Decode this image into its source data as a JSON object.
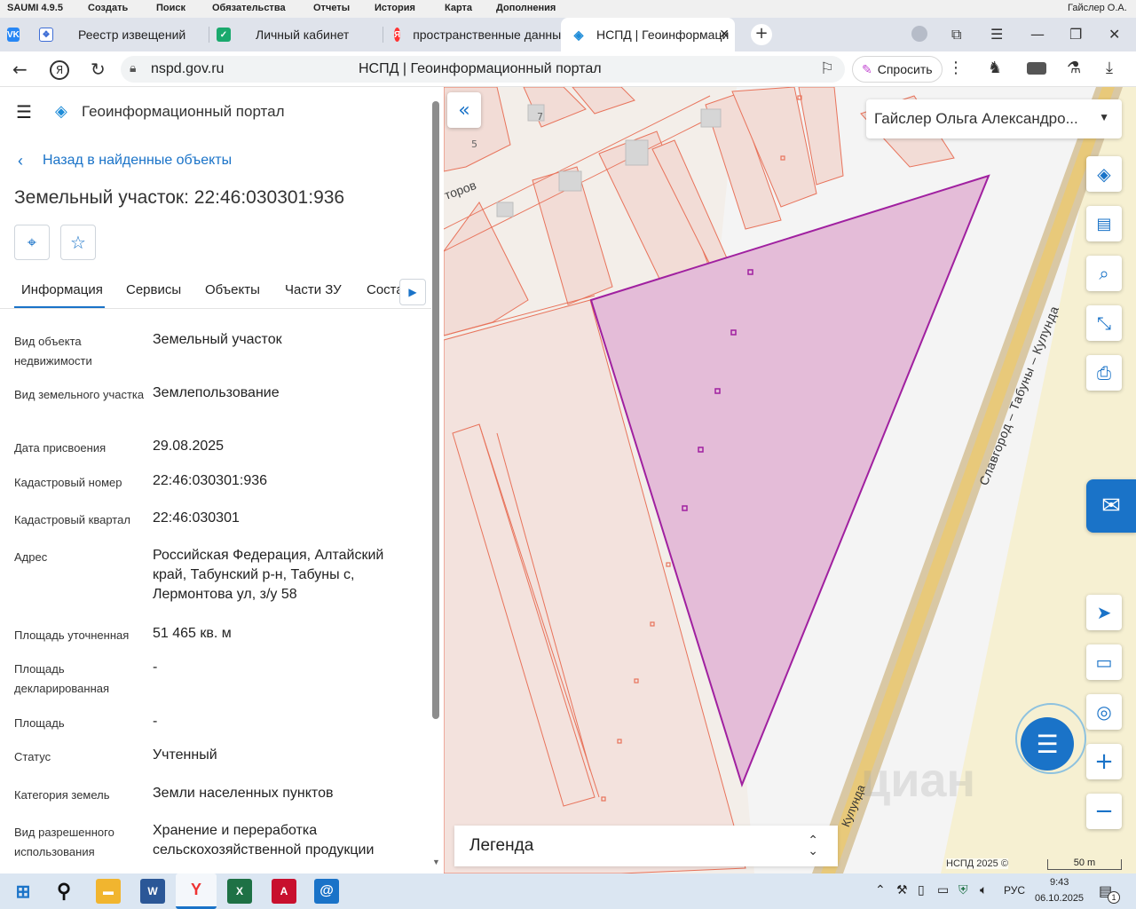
{
  "app_menu": {
    "items": [
      "SAUMI 4.9.5",
      "Создать",
      "Поиск",
      "Обязательства",
      "Отчеты",
      "История",
      "Карта",
      "Дополнения"
    ],
    "user": "Гайслер О.А."
  },
  "browser": {
    "tabs": [
      {
        "label": "Реестр извещений",
        "icon": "gosuslugi-icon"
      },
      {
        "label": "Личный кабинет",
        "icon": "cabinet-icon"
      },
      {
        "label": "пространственные данны",
        "icon": "yandex-icon"
      },
      {
        "label": "НСПД | Геоинформаци",
        "icon": "nspd-icon",
        "active": true
      }
    ],
    "url": "nspd.gov.ru",
    "page_title": "НСПД | Геоинформационный портал",
    "ask_label": "Спросить"
  },
  "panel": {
    "portal_title": "Геоинформационный портал",
    "back_label": "Назад в найденные объекты",
    "object_title": "Земельный участок: 22:46:030301:936",
    "tabs": [
      "Информация",
      "Сервисы",
      "Объекты",
      "Части ЗУ",
      "Соста"
    ],
    "attrs": [
      {
        "label": "Вид объекта недвижимости",
        "value": "Земельный участок"
      },
      {
        "label": "Вид земельного участка",
        "value": "Землепользование"
      },
      {
        "label": "Дата присвоения",
        "value": "29.08.2025"
      },
      {
        "label": "Кадастровый номер",
        "value": "22:46:030301:936"
      },
      {
        "label": "Кадастровый квартал",
        "value": "22:46:030301"
      },
      {
        "label": "Адрес",
        "value": "Российская Федерация, Алтайский край, Табунский р-н, Табуны с, Лермонтова ул, з/у 58"
      },
      {
        "label": "Площадь уточненная",
        "value": "51 465 кв. м"
      },
      {
        "label": "Площадь декларированная",
        "value": "-"
      },
      {
        "label": "Площадь",
        "value": "-"
      },
      {
        "label": "Статус",
        "value": "Учтенный"
      },
      {
        "label": "Категория земель",
        "value": "Земли населенных пунктов"
      },
      {
        "label": "Вид разрешенного использования",
        "value": "Хранение и переработка сельскохозяйственной продукции"
      }
    ]
  },
  "map": {
    "user_select": "Гайслер Ольга Александро...",
    "road_label": "Славгород – Табуны – Кулунда",
    "road_label2": "Кулунда",
    "street_label": "торов",
    "house_numbers": [
      "5",
      "7"
    ],
    "legend_label": "Легенда",
    "copyright": "НСПД 2025 ©",
    "scale": "50 m",
    "watermark": "циан",
    "parcel_color": "#a020a0",
    "parcel_fill": "#e4bcd8"
  },
  "taskbar": {
    "lang": "РУС",
    "time": "9:43",
    "date": "06.10.2025",
    "notif_count": "1"
  }
}
